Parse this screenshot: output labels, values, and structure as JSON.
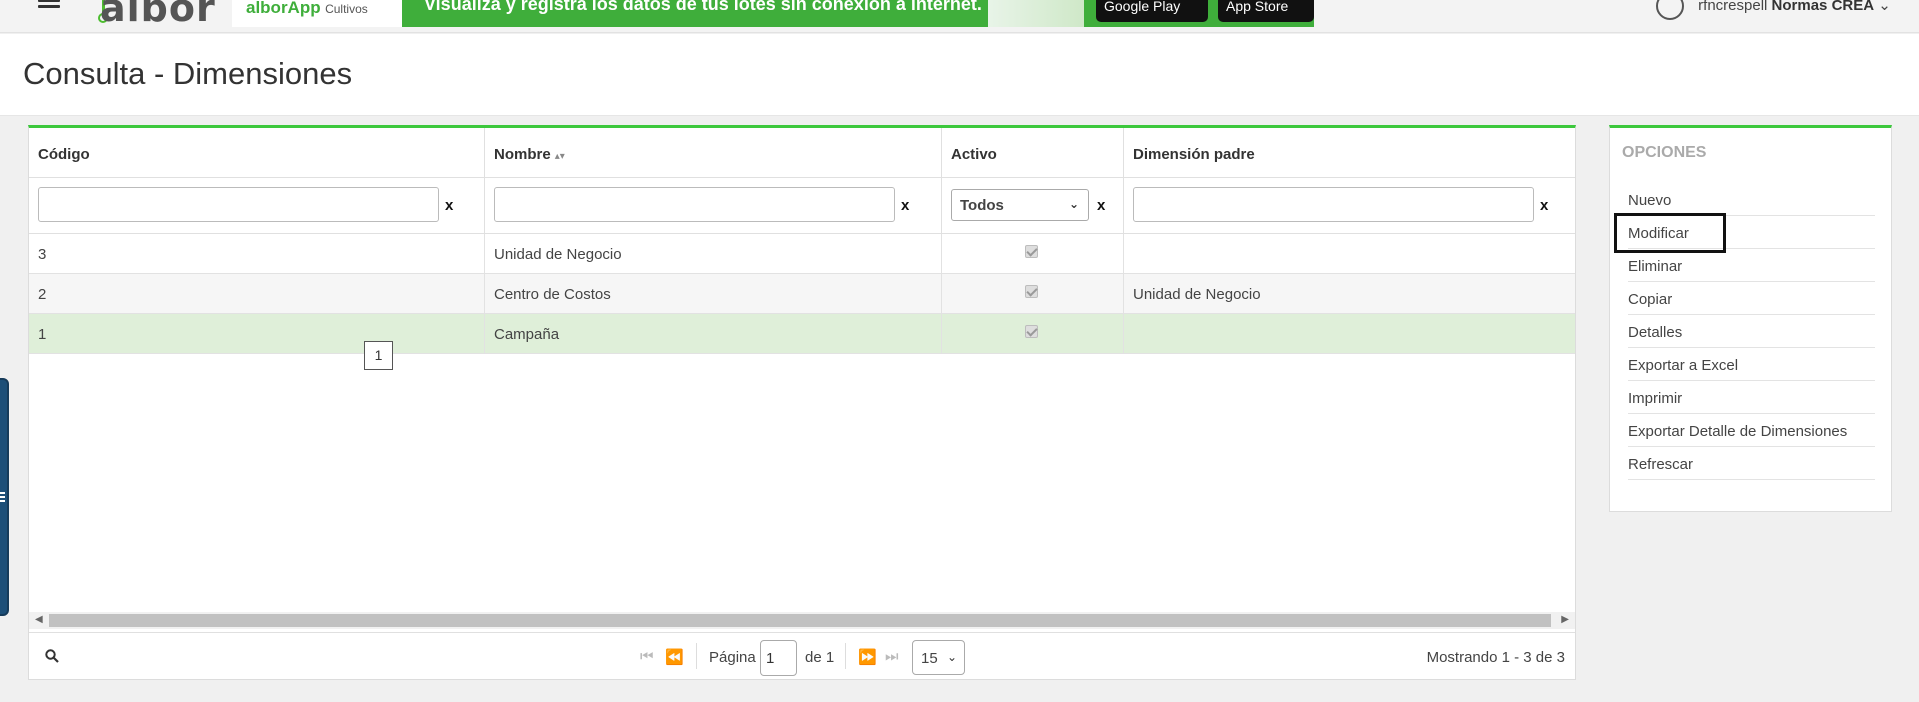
{
  "header": {
    "logo_text": "albor",
    "banner": {
      "brand": "alborApp",
      "brand_sub": "Cultivos",
      "message": "Visualiza y registra los datos de tus lotes sin conexión a internet.",
      "store_google": "Google Play",
      "store_apple": "App Store"
    },
    "user": {
      "name": "rfncrespell",
      "company": "Normas CREA"
    }
  },
  "page": {
    "title": "Consulta - Dimensiones"
  },
  "grid": {
    "columns": [
      "Código",
      "Nombre",
      "Activo",
      "Dimensión padre"
    ],
    "filters": {
      "clear_label": "x",
      "activo_value": "Todos"
    },
    "rows": [
      {
        "codigo": "3",
        "nombre": "Unidad de Negocio",
        "activo": true,
        "padre": ""
      },
      {
        "codigo": "2",
        "nombre": "Centro de Costos",
        "activo": true,
        "padre": "Unidad de Negocio"
      },
      {
        "codigo": "1",
        "nombre": "Campaña",
        "activo": true,
        "padre": ""
      }
    ],
    "tooltip": "1",
    "pager": {
      "page_label": "Página",
      "page_value": "1",
      "of_label": "de 1",
      "page_size": "15",
      "count_text": "Mostrando 1 - 3 de 3"
    }
  },
  "options": {
    "title": "OPCIONES",
    "items": [
      "Nuevo",
      "Modificar",
      "Eliminar",
      "Copiar",
      "Detalles",
      "Exportar a Excel",
      "Imprimir",
      "Exportar Detalle de Dimensiones",
      "Refrescar"
    ]
  },
  "colors": {
    "accent": "#3cc83c",
    "selected_row": "#dfefd9",
    "banner": "#3fae3b",
    "side_tab": "#1d4f78"
  }
}
